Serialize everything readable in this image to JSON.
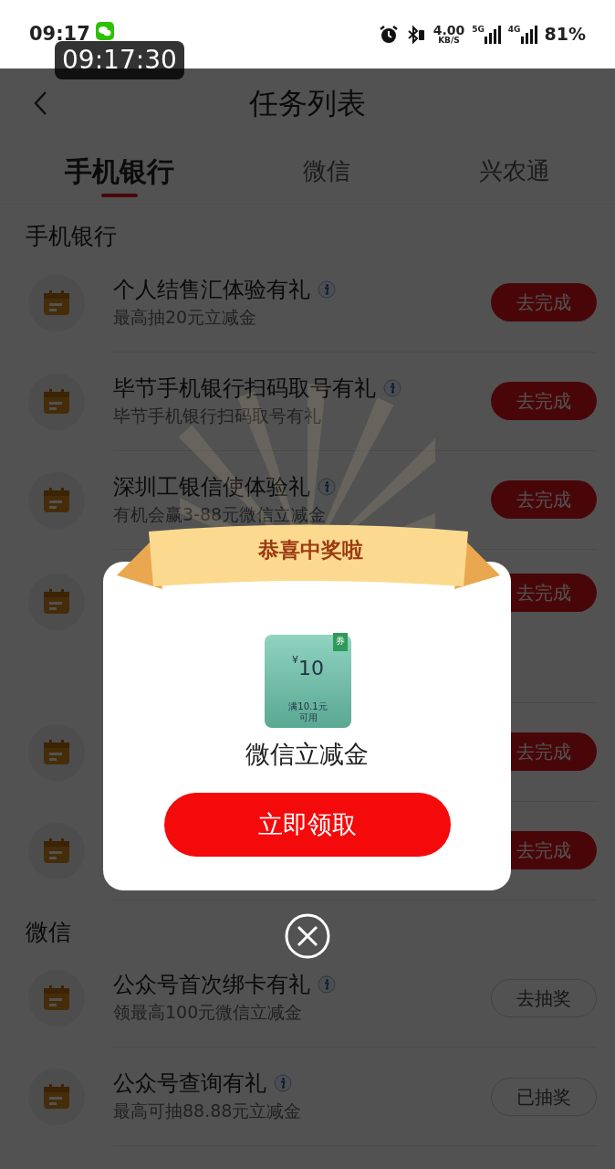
{
  "status_bar": {
    "time": "09:17",
    "recorder_time": "09:17:30",
    "net_speed": "4.00",
    "net_speed_unit": "KB/S",
    "network_1": "5G",
    "network_2": "4G",
    "battery": "81%"
  },
  "header": {
    "title": "任务列表"
  },
  "tabs": [
    {
      "label": "手机银行",
      "selected": true
    },
    {
      "label": "微信",
      "selected": false
    },
    {
      "label": "兴农通",
      "selected": false
    }
  ],
  "sections": [
    {
      "title": "手机银行",
      "tasks": [
        {
          "title": "个人结售汇体验有礼",
          "subtitle": "最高抽20元立减金",
          "button": "去完成",
          "kind": "filled"
        },
        {
          "title": "毕节手机银行扫码取号有礼",
          "subtitle": "毕节手机银行扫码取号有礼",
          "button": "去完成",
          "kind": "filled"
        },
        {
          "title": "深圳工银信使体验礼",
          "subtitle": "有机会赢3-88元微信立减金",
          "button": "去完成",
          "kind": "filled"
        },
        {
          "button": "去完成",
          "kind": "filled"
        },
        {
          "button": "去完成",
          "kind": "filled"
        },
        {
          "button": "去完成",
          "kind": "filled"
        }
      ]
    },
    {
      "title": "微信",
      "tasks": [
        {
          "title": "公众号首次绑卡有礼",
          "subtitle": "领最高100元微信立减金",
          "button": "去抽奖",
          "kind": "outline"
        },
        {
          "title": "公众号查询有礼",
          "subtitle": "最高可抽88.88元立减金",
          "button": "已抽奖",
          "kind": "outline"
        }
      ]
    }
  ],
  "popup": {
    "banner": "恭喜中奖啦",
    "coupon": {
      "badge": "券",
      "currency": "¥",
      "amount": "10",
      "condition": "满10.1元",
      "condition_2": "可用"
    },
    "prize": "微信立减金",
    "claim_button": "立即领取"
  }
}
